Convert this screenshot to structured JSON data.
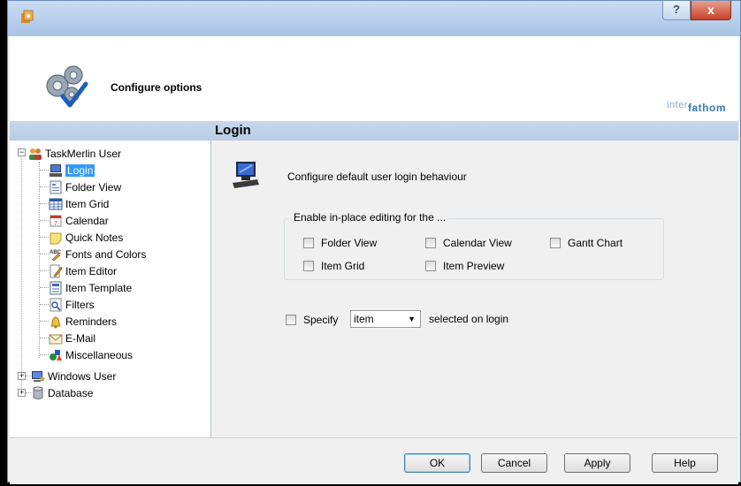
{
  "window": {
    "help_label": "?",
    "close_label": "x"
  },
  "header": {
    "title": "Configure options",
    "brand_part1": "inter",
    "brand_part2": "fathom"
  },
  "section": {
    "title": "Login"
  },
  "tree": {
    "root_label": "TaskMerlin User",
    "children": [
      {
        "label": "Login",
        "icon": "computer-icon"
      },
      {
        "label": "Folder View",
        "icon": "folder-view-icon"
      },
      {
        "label": "Item Grid",
        "icon": "grid-icon"
      },
      {
        "label": "Calendar",
        "icon": "calendar-icon"
      },
      {
        "label": "Quick Notes",
        "icon": "note-icon"
      },
      {
        "label": "Fonts and Colors",
        "icon": "fonts-icon"
      },
      {
        "label": "Item Editor",
        "icon": "editor-icon"
      },
      {
        "label": "Item Template",
        "icon": "template-icon"
      },
      {
        "label": "Filters",
        "icon": "filter-icon"
      },
      {
        "label": "Reminders",
        "icon": "bell-icon"
      },
      {
        "label": "E-Mail",
        "icon": "mail-icon"
      },
      {
        "label": "Miscellaneous",
        "icon": "misc-icon"
      }
    ],
    "siblings": [
      {
        "label": "Windows User",
        "icon": "windows-user-icon"
      },
      {
        "label": "Database",
        "icon": "database-icon"
      }
    ],
    "expand_symbol": "+",
    "collapse_symbol": "−"
  },
  "content": {
    "description": "Configure default user login behaviour",
    "group_label": "Enable in-place editing for the ...",
    "checkboxes": {
      "folder_view": "Folder View",
      "calendar_view": "Calendar View",
      "gantt_chart": "Gantt Chart",
      "item_grid": "Item Grid",
      "item_preview": "Item Preview"
    },
    "specify_label": "Specify",
    "specify_value": "item",
    "selected_on_login": "selected on login"
  },
  "buttons": {
    "ok": "OK",
    "cancel": "Cancel",
    "apply": "Apply",
    "help": "Help"
  },
  "colors": {
    "selection": "#3399ff",
    "section_bar": "#c8d8ec",
    "brand": "#3a7ab8"
  }
}
